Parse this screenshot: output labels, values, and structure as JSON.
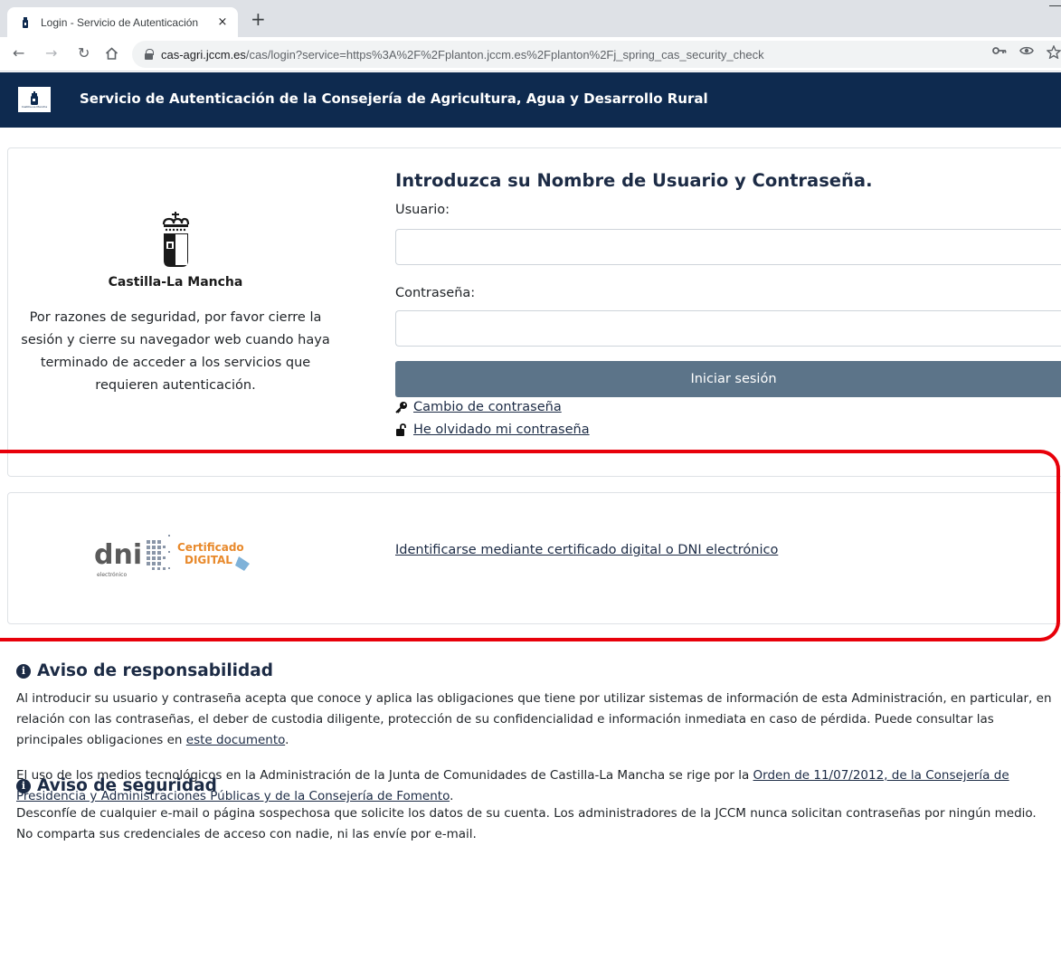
{
  "browser": {
    "tab_title": "Login - Servicio de Autenticación",
    "tab_close": "×",
    "new_tab": "+",
    "url_host": "cas-agri.jccm.es",
    "url_path": "/cas/login?service=https%3A%2F%2Fplanton.jccm.es%2Fplanton%2Fj_spring_cas_security_check"
  },
  "header": {
    "title": "Servicio de Autenticación de la Consejería de Agricultura, Agua y Desarrollo Rural"
  },
  "brand": {
    "name": "Castilla-La Mancha",
    "security_note": "Por razones de seguridad, por favor cierre la sesión y cierre su navegador web cuando haya terminado de acceder a los servicios que requieren autenticación."
  },
  "login": {
    "title": "Introduzca su Nombre de Usuario y Contraseña.",
    "user_label": "Usuario:",
    "user_value": "",
    "password_label": "Contraseña:",
    "password_value": "",
    "submit_label": "Iniciar sesión",
    "change_password_link": "Cambio de contraseña",
    "forgot_password_link": "He olvidado mi contraseña"
  },
  "certificate": {
    "logo_dni": "dni",
    "logo_dni_sub": "electrónico",
    "logo_cert_line1": "Certificado",
    "logo_cert_line2": "DIGITAL",
    "link": "Identificarse mediante certificado digital o DNI electrónico"
  },
  "notices": {
    "responsibility": {
      "title": "Aviso de responsabilidad",
      "p1_text": "Al introducir su usuario y contraseña acepta que conoce y aplica las obligaciones que tiene por utilizar sistemas de información de esta Administración, en particular, en relación con las contraseñas, el deber de custodia diligente, protección de su confidencialidad e información inmediata en caso de pérdida. Puede consultar las principales obligaciones en ",
      "p1_link": "este documento",
      "p1_end": ".",
      "p2_text": "El uso de los medios tecnológicos en la Administración de la Junta de Comunidades de Castilla-La Mancha se rige por la ",
      "p2_link": "Orden de 11/07/2012, de la Consejería de Presidencia y Administraciones Públicas y de la Consejería de Fomento",
      "p2_end": "."
    },
    "security": {
      "title": "Aviso de seguridad",
      "text": "Desconfíe de cualquier e-mail o página sospechosa que solicite los datos de su cuenta. Los administradores de la JCCM nunca solicitan contraseñas por ningún medio. No comparta sus credenciales de acceso con nadie, ni las envíe por e-mail."
    }
  },
  "colors": {
    "header_bg": "#0e2a4f",
    "button_bg": "#5c7489",
    "link": "#1c2b45",
    "highlight": "#e8000a",
    "logo_orange": "#e8892b",
    "logo_grey": "#5a5a5a"
  }
}
